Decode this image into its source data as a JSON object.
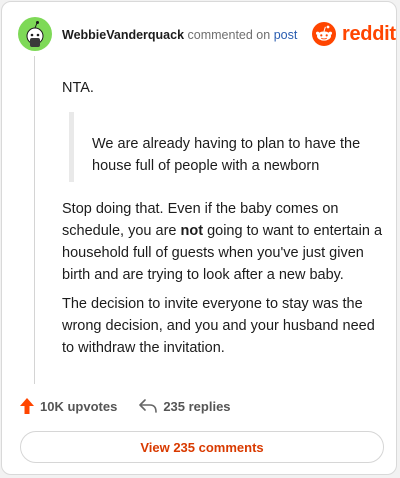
{
  "header": {
    "author": "WebbieVanderquack",
    "action": "commented on",
    "post_link": "post",
    "brand": "reddit"
  },
  "comment": {
    "verdict": "NTA.",
    "quote": "We are already having to plan to have the house full of people with a newborn",
    "p2_before": "Stop doing that. Even if the baby comes on schedule, you are ",
    "p2_emphasis": "not",
    "p2_after": " going to want to entertain a household full of guests when you've just given birth and are trying to look after a new baby.",
    "p3": "The decision to invite everyone to stay was the wrong decision, and you and your husband need to withdraw the invitation."
  },
  "stats": {
    "upvotes": "10K upvotes",
    "replies": "235 replies"
  },
  "view_comments": "View 235 comments",
  "colors": {
    "brand": "#ff4500",
    "link": "#2a5db0",
    "avatar_bg": "#7ed957",
    "cta": "#d93a00"
  },
  "icons": {
    "avatar": "snoo-avatar",
    "brand": "reddit-logo",
    "upvote": "upvote-arrow-icon",
    "reply": "reply-arrow-icon"
  }
}
